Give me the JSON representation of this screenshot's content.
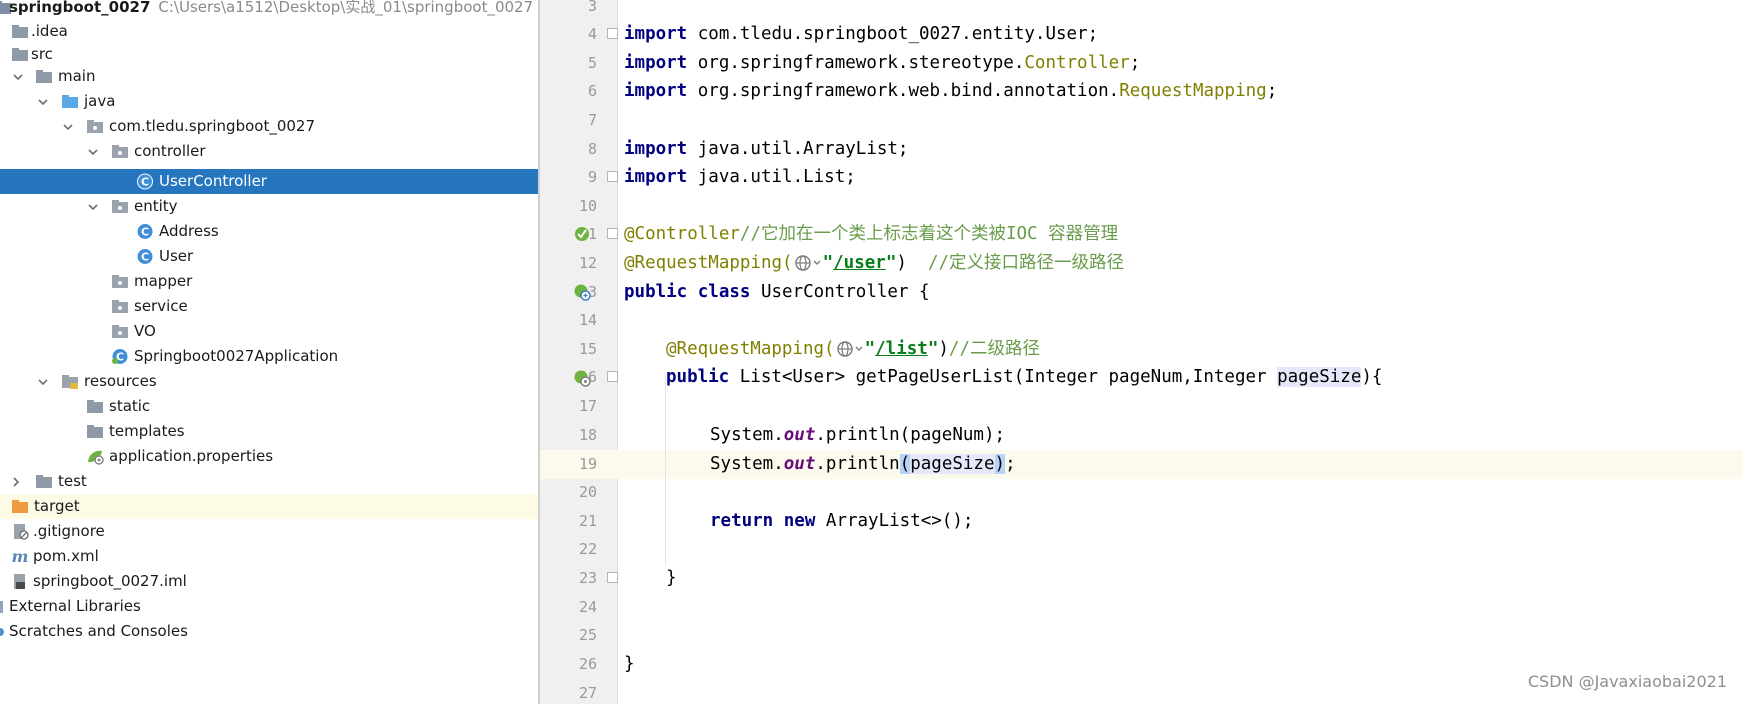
{
  "project": {
    "name": "springboot_0027",
    "path": "C:\\Users\\a1512\\Desktop\\实战_01\\springboot_0027"
  },
  "tree": {
    "idea": ".idea",
    "src": "src",
    "main": "main",
    "java": "java",
    "package": "com.tledu.springboot_0027",
    "controller": "controller",
    "user_controller": "UserController",
    "entity": "entity",
    "address": "Address",
    "user": "User",
    "mapper": "mapper",
    "service": "service",
    "vo": "VO",
    "application_class": "Springboot0027Application",
    "resources": "resources",
    "static": "static",
    "templates": "templates",
    "app_properties": "application.properties",
    "test": "test",
    "target": "target",
    "gitignore": ".gitignore",
    "pom": "pom.xml",
    "iml": "springboot_0027.iml",
    "external_libraries": "External Libraries",
    "scratches": "Scratches and Consoles"
  },
  "editor": {
    "line_numbers": [
      "3",
      "4",
      "5",
      "6",
      "7",
      "8",
      "9",
      "10",
      "11",
      "12",
      "13",
      "14",
      "15",
      "16",
      "17",
      "18",
      "19",
      "20",
      "21",
      "22",
      "23",
      "24",
      "25",
      "26",
      "27"
    ],
    "tokens": {
      "import": "import",
      "l4_pkg": " com.tledu.springboot_0027.entity.User;",
      "l5_pkg": " org.springframework.stereotype.",
      "l5_cls": "Controller",
      "l6_pkg": " org.springframework.web.bind.annotation.",
      "l6_cls": "RequestMapping",
      "semicolon": ";",
      "l8_pkg": " java.util.ArrayList;",
      "l9_pkg": " java.util.List;",
      "l11_ann": "@Controller",
      "l11_cmt": "//它加在一个类上标志着这个类被IOC 容器管理",
      "l12_ann": "@RequestMapping(",
      "quote": "\"",
      "l12_url": "/user",
      "l12_close": ")  ",
      "l12_cmt": "//定义接口路径一级路径",
      "public": "public",
      "class": "class",
      "l13_rest": " UserController {",
      "l15_ann": "@RequestMapping(",
      "l15_url": "/list",
      "l15_close": ")",
      "l15_cmt": "//二级路径",
      "l16_sig": " List<User> getPageUserList(Integer pageNum,Integer ",
      "l16_param": "pageSize",
      "l16_end": "){",
      "system": "System.",
      "out": "out",
      "l18_rest": ".println(pageNum);",
      "l19_print": ".println",
      "l19_open": "(",
      "l19_param": "pageSize",
      "l19_close": ")",
      "return": "return",
      "new": "new",
      "l21_rest": " ArrayList<>();",
      "close_brace": "}"
    }
  },
  "watermark": "CSDN @Javaxiaobai2021"
}
